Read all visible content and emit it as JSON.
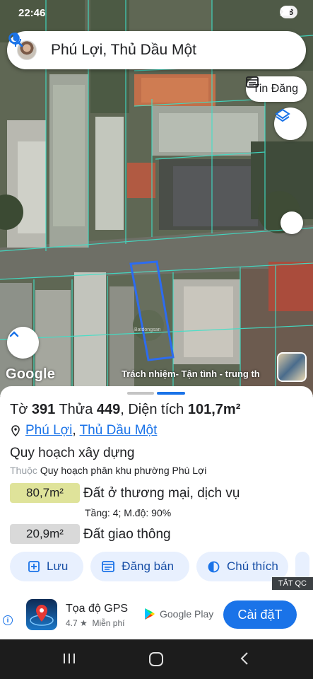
{
  "status": {
    "time": "22:46",
    "battery": "58"
  },
  "search": {
    "query": "Phú Lợi, Thủ Dầu Một"
  },
  "map_buttons": {
    "tin_dang": "Tin Đăng"
  },
  "map": {
    "logo": "Google",
    "banner": "Trách nhiệm- Tận tình - trung th",
    "watermark": "Batdongsan"
  },
  "sheet": {
    "to_label": "Tờ ",
    "to_value": "391",
    "thua_label": " Thửa ",
    "thua_value": "449",
    "dt_label": ", Diện tích ",
    "dt_value": "101,7m²",
    "ward": "Phú Lợi",
    "sep": ",",
    "city": "Thủ Dầu Một",
    "plan_title": "Quy hoạch xây dựng",
    "plan_prefix": "Thuộc ",
    "plan_name": "Quy hoạch phân khu phường Phú Lợi",
    "zones": [
      {
        "area": "80,7m²",
        "label": "Đất ở thương mại, dịch vụ",
        "detail": "Tầng: 4; M.độ: 90%",
        "color": "#dfe39a"
      },
      {
        "area": "20,9m²",
        "label": "Đất giao thông",
        "color": "#d9d9d9"
      }
    ],
    "actions": {
      "save": "Lưu",
      "post": "Đăng bán",
      "legend": "Chú thích"
    }
  },
  "ad": {
    "close": "TẮT QC",
    "app_name": "Tọa độ GPS",
    "rating": "4.7 ★",
    "price": "Miễn phí",
    "store": "Google Play",
    "install": "Cài đặT"
  },
  "colors": {
    "accent": "#1a73e8",
    "chip_bg": "#e8f0fe",
    "parcel_outline": "#2d6cf0",
    "lot_lines": "#3fe0c8"
  }
}
